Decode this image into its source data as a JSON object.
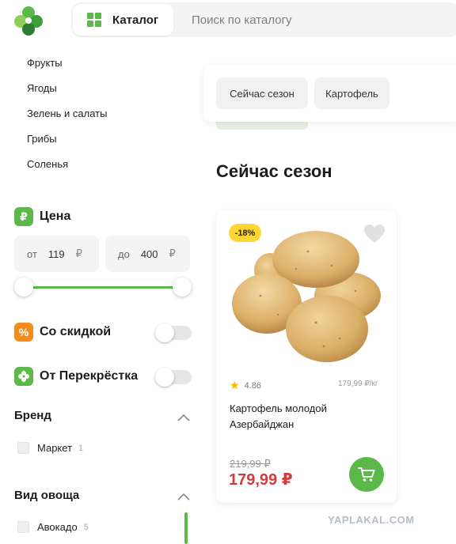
{
  "header": {
    "catalog_label": "Каталог",
    "search_placeholder": "Поиск по каталогу"
  },
  "sidebar": {
    "categories": [
      "Фрукты",
      "Ягоды",
      "Зелень и салаты",
      "Грибы",
      "Соленья"
    ],
    "price": {
      "title": "Цена",
      "icon_label": "₽",
      "from_prefix": "от",
      "from_value": "119",
      "to_prefix": "до",
      "to_value": "400",
      "currency": "₽",
      "range": [
        119,
        400
      ]
    },
    "discount_filter": {
      "label": "Со скидкой",
      "icon_label": "%",
      "enabled": false
    },
    "perekrestok_filter": {
      "label": "От Перекрёстка",
      "enabled": false
    },
    "brand": {
      "title": "Бренд",
      "items": [
        {
          "label": "Маркет",
          "count": "1"
        }
      ]
    },
    "veg_type": {
      "title": "Вид овоща",
      "items": [
        {
          "label": "Авокадо",
          "count": "5"
        }
      ]
    }
  },
  "chips": [
    "Сейчас сезон",
    "Картофель"
  ],
  "section_heading": "Сейчас сезон",
  "product": {
    "discount_badge": "-18%",
    "rating": "4.86",
    "unit_price": "179,99 ₽/кг",
    "name": "Картофель молодой Азербайджан",
    "old_price": "219,99 ₽",
    "price": "179,99 ₽"
  },
  "watermark": "YAPLAKAL.COM",
  "colors": {
    "brand_green": "#5ab948",
    "price_red": "#d43c3c",
    "discount_yellow": "#ffd633",
    "discount_icon_orange": "#f28c1e"
  },
  "icons": [
    "logo-icon",
    "grid-icon",
    "ruble-icon",
    "percent-icon",
    "clover-icon",
    "chevron-up-icon",
    "heart-icon",
    "star-icon",
    "cart-icon"
  ]
}
